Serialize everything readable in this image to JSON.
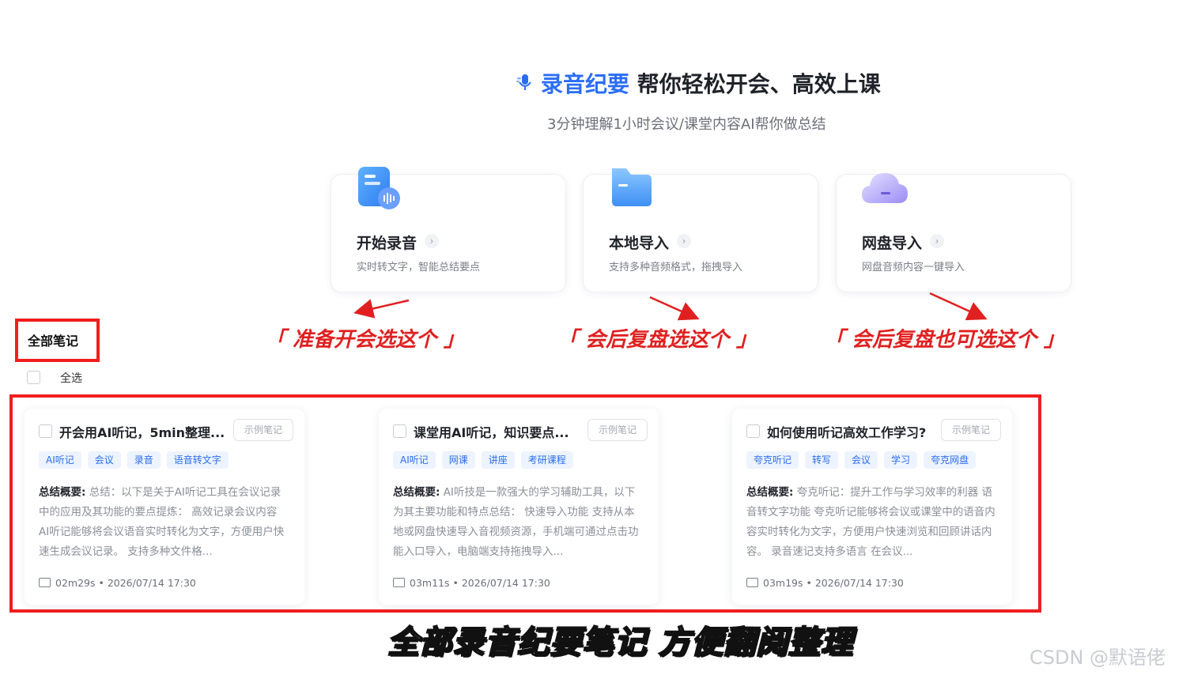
{
  "hero": {
    "brand": "录音纪要",
    "title_rest": " 帮你轻松开会、高效上课",
    "subtitle": "3分钟理解1小时会议/课堂内容AI帮你做总结"
  },
  "actions": [
    {
      "title": "开始录音",
      "desc": "实时转文字，智能总结要点",
      "icon": "audio-document-icon"
    },
    {
      "title": "本地导入",
      "desc": "支持多种音频格式，拖拽导入",
      "icon": "folder-icon"
    },
    {
      "title": "网盘导入",
      "desc": "网盘音频内容一键导入",
      "icon": "cloud-icon"
    }
  ],
  "annotations": [
    "「 准备开会选这个 」",
    "「 会后复盘选这个 」",
    "「 会后复盘也可选这个 」"
  ],
  "notes_section": {
    "title": "全部笔记",
    "select_all": "全选"
  },
  "notes": [
    {
      "title": "开会用AI听记，5min整理...",
      "sample": "示例笔记",
      "tags": [
        "AI听记",
        "会议",
        "录音",
        "语音转文字"
      ],
      "summary_label": "总结概要:",
      "summary": " 总结：以下是关于AI听记工具在会议记录中的应用及其功能的要点提炼： 高效记录会议内容 AI听记能够将会议语音实时转化为文字，方便用户快速生成会议记录。 支持多种文件格...",
      "meta": "02m29s • 2026/07/14 17:30"
    },
    {
      "title": "课堂用AI听记，知识要点...",
      "sample": "示例笔记",
      "tags": [
        "AI听记",
        "网课",
        "讲座",
        "考研课程"
      ],
      "summary_label": "总结概要:",
      "summary": " AI听技是一款强大的学习辅助工具，以下为其主要功能和特点总结： 快速导入功能 支持从本地或网盘快速导入音视频资源，手机端可通过点击功能入口导入，电脑端支持拖拽导入...",
      "meta": "03m11s • 2026/07/14 17:30"
    },
    {
      "title": "如何使用听记高效工作学习?",
      "sample": "示例笔记",
      "tags": [
        "夸克听记",
        "转写",
        "会议",
        "学习",
        "夸克网盘"
      ],
      "summary_label": "总结概要:",
      "summary": " 夸克听记：提升工作与学习效率的利器 语音转文字功能 夸克听记能够将会议或课堂中的语音内容实时转化为文字，方便用户快速浏览和回顾讲话内容。 录音速记支持多语言 在会议...",
      "meta": "03m19s • 2026/07/14 17:30"
    }
  ],
  "caption": "全部录音纪要笔记 方便翻阅整理",
  "watermark": "CSDN @默语佬",
  "colors": {
    "accent": "#2a6df5",
    "annotation_red": "#e02020"
  }
}
